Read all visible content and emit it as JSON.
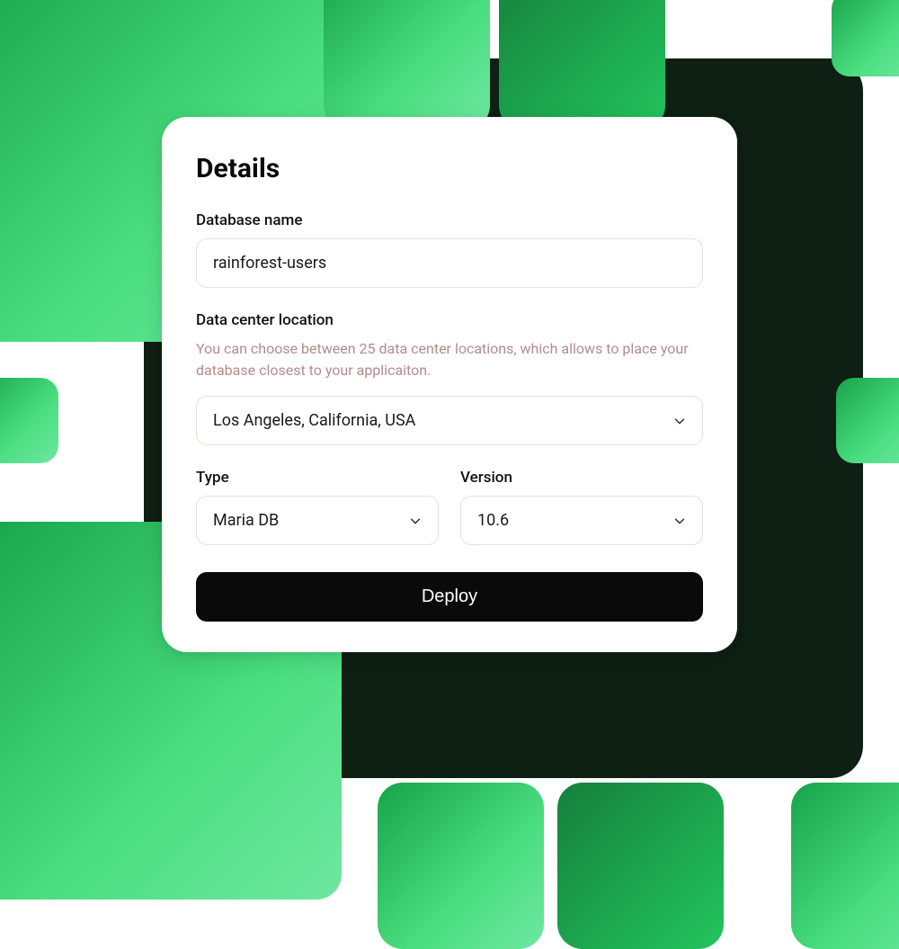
{
  "card": {
    "title": "Details",
    "database_name": {
      "label": "Database name",
      "value": "rainforest-users"
    },
    "location": {
      "label": "Data center location",
      "help": "You can choose between 25 data center locations, which allows to place your database closest to your applicaiton.",
      "value": "Los Angeles, California, USA"
    },
    "type": {
      "label": "Type",
      "value": "Maria DB"
    },
    "version": {
      "label": "Version",
      "value": "10.6"
    },
    "deploy_label": "Deploy"
  }
}
